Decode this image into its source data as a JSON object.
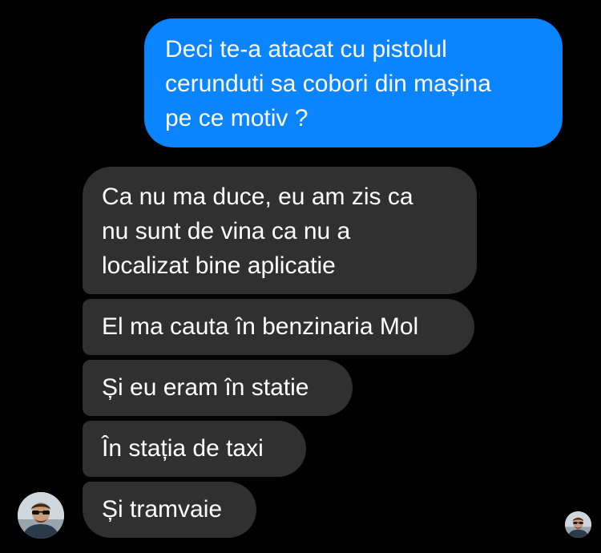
{
  "conversation": {
    "sent_messages": [
      {
        "text": "Deci te-a atacat cu pistolul\ncerunduti sa cobori din mașina\npe ce motiv ?"
      }
    ],
    "received_messages": [
      {
        "text": "Ca nu ma duce, eu am zis ca\nnu sunt de vina ca nu a\nlocalizat bine aplicatie"
      },
      {
        "text": "El ma cauta în benzinaria Mol"
      },
      {
        "text": "Și eu eram în statie"
      },
      {
        "text": "În stația de taxi"
      },
      {
        "text": "Și tramvaie"
      }
    ]
  },
  "colors": {
    "background": "#000000",
    "sent_bubble": "#0a84ff",
    "received_bubble": "#303030",
    "text": "#ffffff"
  },
  "icons": {
    "contact_avatar": "person-avatar",
    "read_receipt_avatar": "person-avatar-small"
  }
}
